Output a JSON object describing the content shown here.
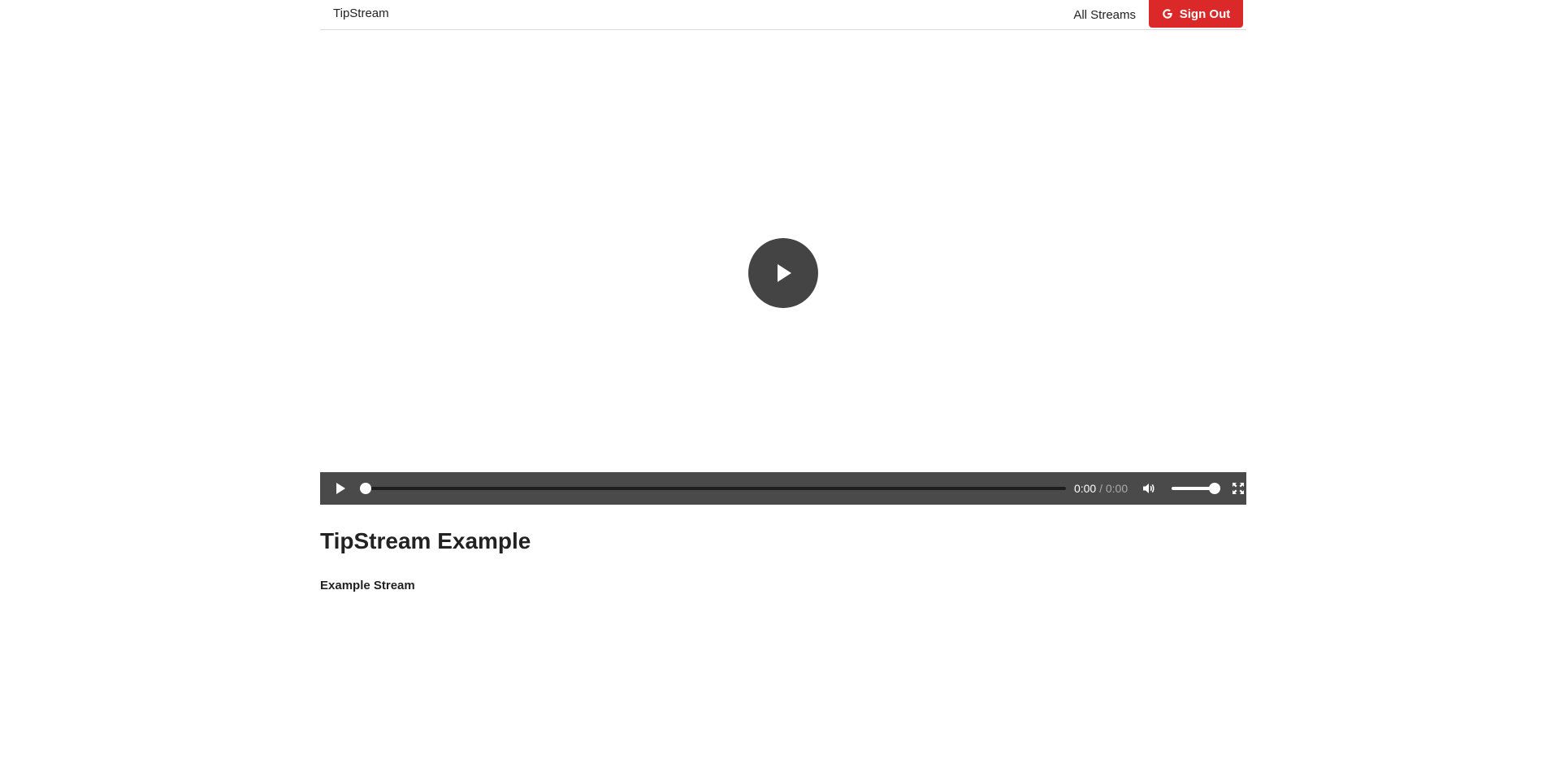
{
  "navbar": {
    "brand": "TipStream",
    "all_streams": "All Streams",
    "sign_out": "Sign Out",
    "sign_out_icon": "google-icon",
    "sign_out_color": "#db2828"
  },
  "player": {
    "big_play_icon": "play-icon",
    "play_icon": "play-icon",
    "current_time": "0:00",
    "separator": "/",
    "duration": "0:00",
    "progress": 0,
    "volume": 1,
    "mute_icon": "volume-icon",
    "fullscreen_icon": "fullscreen-icon"
  },
  "content": {
    "title": "TipStream Example",
    "subtitle": "Example Stream"
  }
}
